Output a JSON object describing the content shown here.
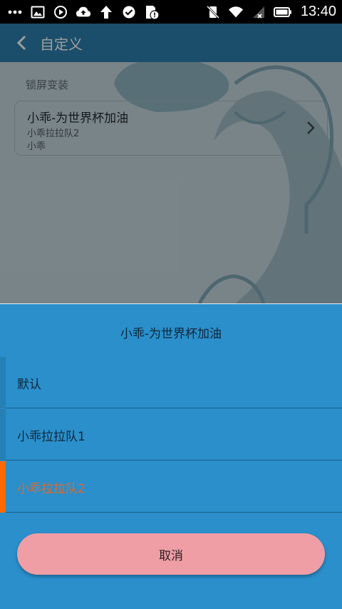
{
  "status_bar": {
    "time": "13:40",
    "left_icons": [
      "more-dots-icon",
      "image-icon",
      "play-icon",
      "cloud-upload-icon",
      "upload-arrow-icon",
      "check-circle-icon",
      "sd-card-alert-icon"
    ],
    "right_icons": [
      "vibrate-off-icon",
      "wifi-icon",
      "signal-icon",
      "battery-icon"
    ]
  },
  "appbar": {
    "title": "自定义"
  },
  "section": {
    "label": "锁屏变装"
  },
  "card": {
    "title": "小乖-为世界杯加油",
    "subtitle": "小乖拉拉队2",
    "subtitle2": "小乖"
  },
  "sheet": {
    "title": "小乖-为世界杯加油",
    "options": [
      {
        "label": "默认",
        "selected": false
      },
      {
        "label": "小乖拉拉队1",
        "selected": false
      },
      {
        "label": "小乖拉拉队2",
        "selected": true
      }
    ],
    "cancel_label": "取消"
  },
  "colors": {
    "sheet_bg": "#2a8fcb",
    "selected_accent": "#ff6a00",
    "cancel_bg": "#ef9ea5",
    "appbar_bg": "#2c7fab"
  }
}
